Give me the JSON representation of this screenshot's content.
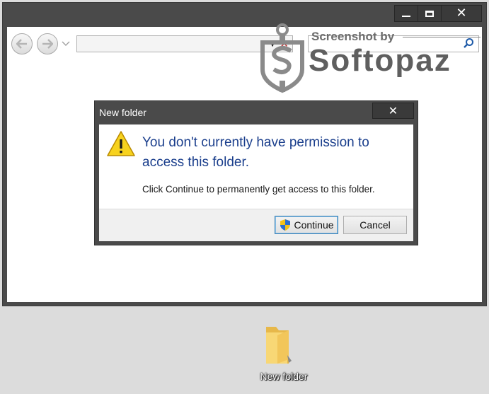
{
  "watermark": {
    "small": "Screenshot by",
    "big": "Softopaz"
  },
  "dialog": {
    "title": "New folder",
    "main_text": "You don't currently have permission to access this folder.",
    "sub_text": "Click Continue to permanently get access to this folder.",
    "continue_label": "Continue",
    "cancel_label": "Cancel"
  },
  "desktop": {
    "folder_label": "New folder"
  },
  "colors": {
    "main_text": "#1a3e8c",
    "frame": "#4a4a4a",
    "warning": "#f7d21e"
  }
}
